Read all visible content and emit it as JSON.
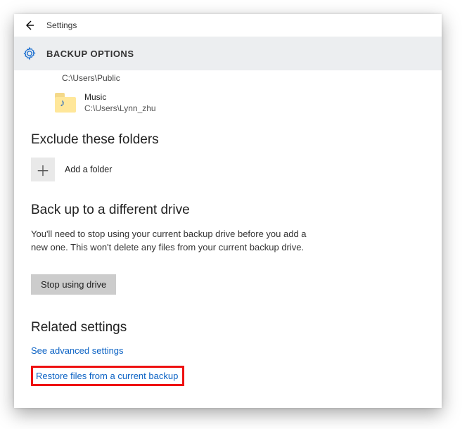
{
  "titlebar": {
    "app_name": "Settings"
  },
  "header": {
    "page_title": "BACKUP OPTIONS"
  },
  "truncated_prev_path": "C:\\Users\\Public",
  "current_folder": {
    "name": "Music",
    "path": "C:\\Users\\Lynn_zhu"
  },
  "sections": {
    "exclude_heading": "Exclude these folders",
    "add_folder_label": "Add a folder",
    "diff_drive_heading": "Back up to a different drive",
    "diff_drive_body": "You'll need to stop using your current backup drive before you add a new one. This won't delete any files from your current backup drive.",
    "stop_button_label": "Stop using drive",
    "related_heading": "Related settings",
    "link_advanced": "See advanced settings",
    "link_restore": "Restore files from a current backup"
  }
}
